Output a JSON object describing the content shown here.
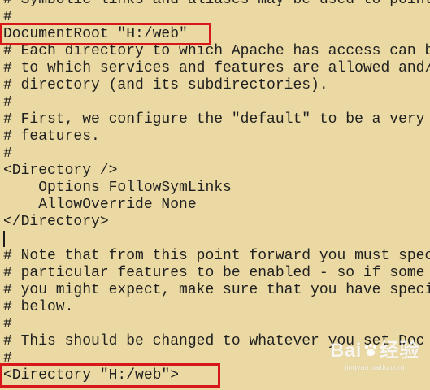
{
  "editor": {
    "lines": [
      "# Symbolic links and aliases may be used to point",
      "#",
      "DocumentRoot \"H:/web\"",
      "# Each directory to which Apache has access can be",
      "# to which services and features are allowed and/",
      "# directory (and its subdirectories).",
      "#",
      "# First, we configure the \"default\" to be a very",
      "# features.",
      "#",
      "<Directory />",
      "    Options FollowSymLinks",
      "    AllowOverride None",
      "</Directory>",
      "",
      "# Note that from this point forward you must spec",
      "# particular features to be enabled - so if some",
      "# you might expect, make sure that you have speci",
      "# below.",
      "#",
      "# This should be changed to whatever you set Doc",
      "#",
      "<Directory \"H:/web\">"
    ],
    "highlight_color": "#d8171b",
    "background_color": "#ead9a3"
  },
  "watermark": {
    "logo_left": "Bai",
    "logo_right": "经验",
    "url": "jingyan.baidu.com"
  }
}
